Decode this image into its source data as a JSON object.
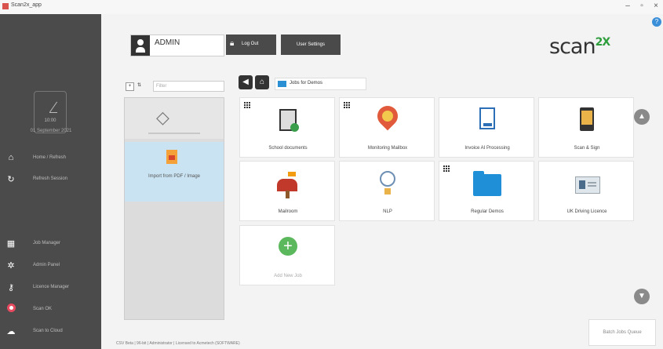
{
  "window": {
    "title": "Scan2x_app"
  },
  "sidebar": {
    "clock_time": "10:00",
    "date": "01 September 2021",
    "items_top": [
      {
        "icon": "home-icon",
        "label": "Home / Refresh"
      },
      {
        "icon": "refresh-icon",
        "label": "Refresh Session"
      }
    ],
    "items_bottom": [
      {
        "icon": "grid-icon",
        "label": "Job Manager"
      },
      {
        "icon": "gear-icon",
        "label": "Admin Panel"
      },
      {
        "icon": "key-icon",
        "label": "Licence Manager"
      },
      {
        "icon": "target-icon",
        "label": "Scan OK"
      },
      {
        "icon": "cloud-icon",
        "label": "Scan to Cloud"
      }
    ]
  },
  "header": {
    "username": "ADMIN",
    "logout_label": "Log Out",
    "user_settings_label": "User Settings",
    "logo_text": "scan",
    "logo_sup": "2X"
  },
  "tree": {
    "search_placeholder": "Filter",
    "items": [
      {
        "label": ""
      },
      {
        "label": "Import from PDF / Image"
      }
    ]
  },
  "breadcrumb": {
    "folder_label": "Jobs for Demos"
  },
  "tiles": [
    {
      "label": "School documents",
      "icon": "document-icon"
    },
    {
      "label": "Monitoring Mailbox",
      "icon": "location-pin-icon"
    },
    {
      "label": "Invoice AI Processing",
      "icon": "invoice-icon"
    },
    {
      "label": "Scan & Sign",
      "icon": "phone-sign-icon"
    },
    {
      "label": "Mailroom",
      "icon": "mailbox-icon"
    },
    {
      "label": "NLP",
      "icon": "nlp-icon"
    },
    {
      "label": "Regular Demos",
      "icon": "folder-icon"
    },
    {
      "label": "UK Driving Licence",
      "icon": "id-card-icon"
    },
    {
      "label": "Add New Job",
      "icon": "plus-icon"
    }
  ],
  "statusbar": {
    "text": "CSV Beta | 96-bit | Administrator | Licensed to Acmetech (SOFTWARE)"
  },
  "queue_button": {
    "label": "Batch Jobs Queue"
  }
}
